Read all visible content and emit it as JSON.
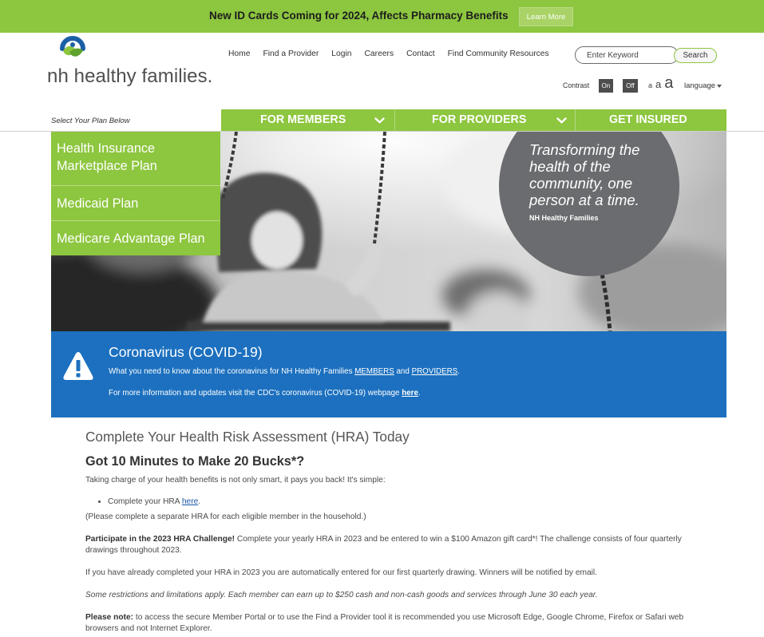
{
  "announcement": {
    "text": "New ID Cards Coming for 2024, Affects Pharmacy Benefits",
    "button_label": "Learn More"
  },
  "logo": {
    "text": "nh healthy families."
  },
  "top_nav": {
    "items": [
      "Home",
      "Find a Provider",
      "Login",
      "Careers",
      "Contact",
      "Find Community Resources"
    ]
  },
  "search": {
    "placeholder": "Enter Keyword",
    "button_label": "Search"
  },
  "accessibility": {
    "contrast_label": "Contrast",
    "contrast_on": "On",
    "contrast_off": "Off",
    "text_size_options": [
      "a",
      "a",
      "a"
    ],
    "language_label": "language"
  },
  "plan_selector": {
    "label": "Select Your Plan Below",
    "plans": [
      "Health Insurance Marketplace Plan",
      "Medicaid Plan",
      "Medicare Advantage Plan"
    ]
  },
  "main_nav": {
    "items": [
      {
        "label": "FOR MEMBERS",
        "has_dropdown": true
      },
      {
        "label": "FOR PROVIDERS",
        "has_dropdown": true
      },
      {
        "label": "GET INSURED",
        "has_dropdown": false
      }
    ]
  },
  "hero": {
    "tagline": "Transforming the health of the community, one person at a time.",
    "attribution": "NH Healthy Families"
  },
  "alert": {
    "title": "Coronavirus (COVID-19)",
    "line1_prefix": "What you need to know about the coronavirus for NH Healthy Families ",
    "members_link": "MEMBERS",
    "line1_mid": " and ",
    "providers_link": "PROVIDERS",
    "line1_suffix": ".",
    "line2_prefix": "For more information and updates visit the CDC's coronavirus (COVID-19) webpage ",
    "here_link": "here",
    "line2_suffix": "."
  },
  "hra": {
    "heading": "Complete Your Health Risk Assessment (HRA) Today",
    "subheading": "Got 10 Minutes to Make 20 Bucks*?",
    "intro": "Taking charge of your health benefits is not only smart, it pays you back! It's simple:",
    "bullet_prefix": "Complete your HRA ",
    "bullet_link": "here",
    "bullet_suffix": ".",
    "separate_note": "(Please complete a separate HRA for each eligible member in the household.)",
    "challenge_bold": "Participate in the 2023 HRA Challenge!",
    "challenge_text": " Complete your yearly HRA in 2023 and be entered to win a $100 Amazon gift card*! The challenge consists of four quarterly drawings throughout 2023.",
    "auto_entry": "If you have already completed your HRA in 2023 you are automatically entered for our first quarterly drawing. Winners will be notified by email.",
    "restrictions": "Some restrictions and limitations apply. Each member can earn up to $250 cash and non-cash goods and services through June 30 each year.",
    "note_bold": "Please note:",
    "note_text": " to access the secure Member Portal or to use the Find a Provider tool it is recommended you use Microsoft Edge, Google Chrome, Firefox or Safari web browsers and not Internet Explorer."
  },
  "icons": [
    "logo-icon",
    "chevron-down-icon",
    "warning-icon",
    "caret-down-icon"
  ],
  "colors": {
    "brand_green": "#8dc63f",
    "alert_blue": "#1c70bf",
    "circle_gray": "#6b6c6f",
    "link_blue": "#1a56a6"
  }
}
